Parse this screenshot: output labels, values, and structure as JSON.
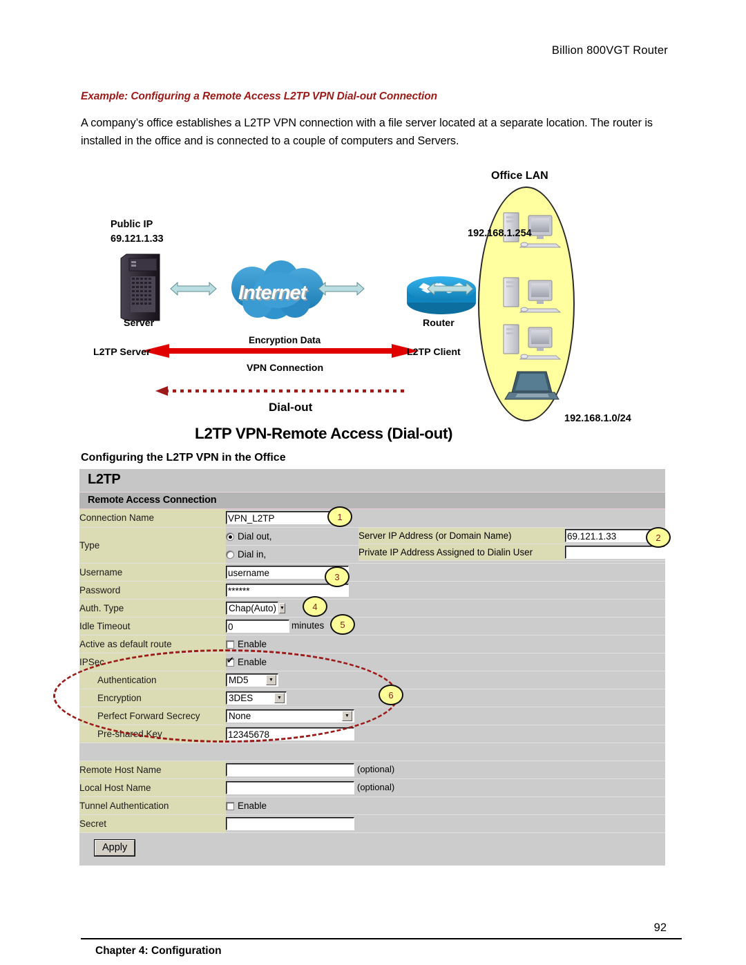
{
  "page_header": "Billion 800VGT Router",
  "example_heading": "Example: Configuring a Remote Access L2TP VPN Dial-out Connection",
  "intro_paragraph": "A company’s office establishes a L2TP VPN connection with a file server located at a separate location. The router is installed in the office and is connected to a couple of computers and Servers.",
  "diagram": {
    "title": "L2TP VPN-Remote Access (Dial-out)",
    "office_lan_title": "Office LAN",
    "public_ip_label": "Public IP",
    "public_ip_value": "69.121.1.33",
    "router_lan_ip": "192.168.1.254",
    "lan_subnet": "192.168.1.0/24",
    "server_label": "Server",
    "router_label": "Router",
    "l2tp_server_label": "L2TP Server",
    "l2tp_client_label": "L2TP Client",
    "encryption_data_label": "Encryption Data",
    "vpn_connection_label": "VPN Connection",
    "dial_out_label": "Dial-out",
    "internet_label": "Internet"
  },
  "config_heading": "Configuring the L2TP VPN in the Office",
  "form": {
    "panel_title": "L2TP",
    "panel_subtitle": "Remote Access Connection",
    "connection_name_label": "Connection Name",
    "connection_name_value": "VPN_L2TP",
    "type_label": "Type",
    "dial_out_label": "Dial out,",
    "dial_in_label": "Dial in,",
    "dial_out_selected": true,
    "server_ip_label": "Server IP Address (or Domain Name)",
    "server_ip_value": "69.121.1.33",
    "private_ip_label": "Private IP Address Assigned to Dialin User",
    "private_ip_value": "",
    "username_label": "Username",
    "username_value": "username",
    "password_label": "Password",
    "password_value": "******",
    "auth_type_label": "Auth. Type",
    "auth_type_value": "Chap(Auto)",
    "idle_timeout_label": "Idle Timeout",
    "idle_timeout_value": "0",
    "idle_timeout_unit": "minutes",
    "active_default_route_label": "Active as default route",
    "active_default_route_enable": "Enable",
    "active_default_route_checked": false,
    "ipsec_label": "IPSec",
    "ipsec_enable": "Enable",
    "ipsec_checked": true,
    "authentication_label": "Authentication",
    "authentication_value": "MD5",
    "encryption_label": "Encryption",
    "encryption_value": "3DES",
    "pfs_label": "Perfect Forward Secrecy",
    "pfs_value": "None",
    "preshared_key_label": "Pre-shared Key",
    "preshared_key_value": "12345678",
    "remote_host_label": "Remote Host Name",
    "remote_host_value": "",
    "remote_host_note": "(optional)",
    "local_host_label": "Local Host Name",
    "local_host_value": "",
    "local_host_note": "(optional)",
    "tunnel_auth_label": "Tunnel Authentication",
    "tunnel_auth_enable": "Enable",
    "tunnel_auth_checked": false,
    "secret_label": "Secret",
    "secret_value": "",
    "apply_button": "Apply"
  },
  "callouts": [
    "1",
    "2",
    "3",
    "4",
    "5",
    "6"
  ],
  "footer": {
    "chapter": "Chapter 4: Configuration",
    "page_number": "92"
  },
  "colors": {
    "heading_red": "#9c1a18",
    "label_cell": "#dcdcb4",
    "value_cell": "#cccccc",
    "panel_title_bg": "#c6c6c6",
    "panel_subtitle_bg": "#b5b5b5",
    "callout_fill": "#ffff99",
    "lan_oval_fill": "#ffffa0",
    "vpn_arrow_red": "#e00000",
    "cloud_blue": "#2b8fc9",
    "router_blue": "#1a9ad6",
    "arrow_teal": "#b9dde0"
  }
}
